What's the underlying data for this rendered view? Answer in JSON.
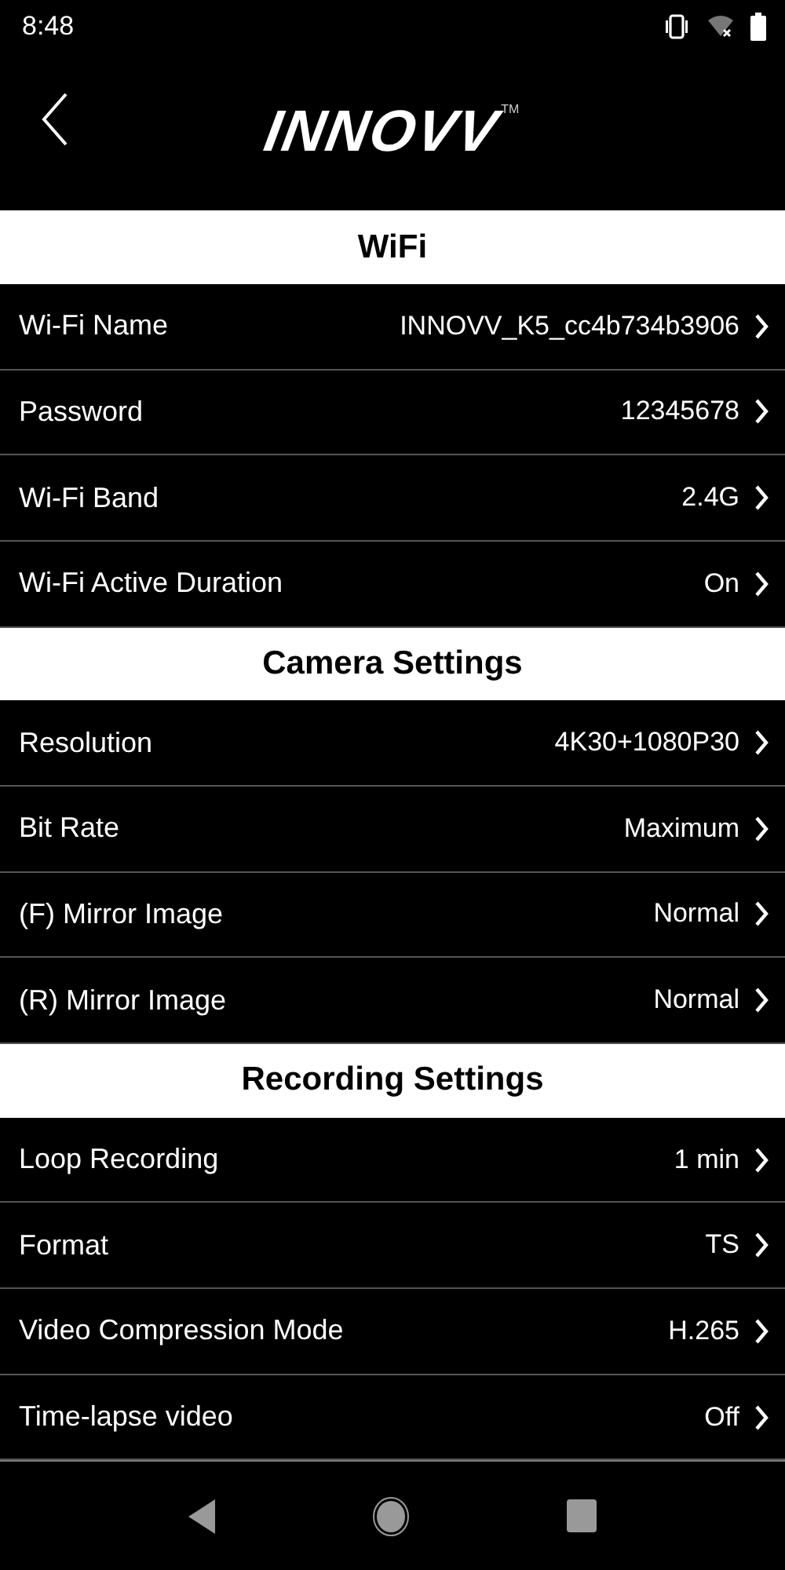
{
  "status_bar": {
    "time": "8:48"
  },
  "header": {
    "logo": "INNOVV",
    "trademark": "TM"
  },
  "sections": [
    {
      "title": "WiFi",
      "rows": [
        {
          "label": "Wi-Fi Name",
          "value": "INNOVV_K5_cc4b734b3906"
        },
        {
          "label": "Password",
          "value": "12345678"
        },
        {
          "label": "Wi-Fi Band",
          "value": "2.4G"
        },
        {
          "label": "Wi-Fi Active Duration",
          "value": "On"
        }
      ]
    },
    {
      "title": "Camera Settings",
      "rows": [
        {
          "label": "Resolution",
          "value": "4K30+1080P30"
        },
        {
          "label": "Bit Rate",
          "value": "Maximum"
        },
        {
          "label": "(F) Mirror Image",
          "value": "Normal"
        },
        {
          "label": "(R) Mirror Image",
          "value": "Normal"
        }
      ]
    },
    {
      "title": "Recording Settings",
      "rows": [
        {
          "label": "Loop Recording",
          "value": "1 min"
        },
        {
          "label": "Format",
          "value": "TS"
        },
        {
          "label": "Video Compression Mode",
          "value": "H.265"
        },
        {
          "label": "Time-lapse video",
          "value": "Off"
        }
      ]
    }
  ]
}
